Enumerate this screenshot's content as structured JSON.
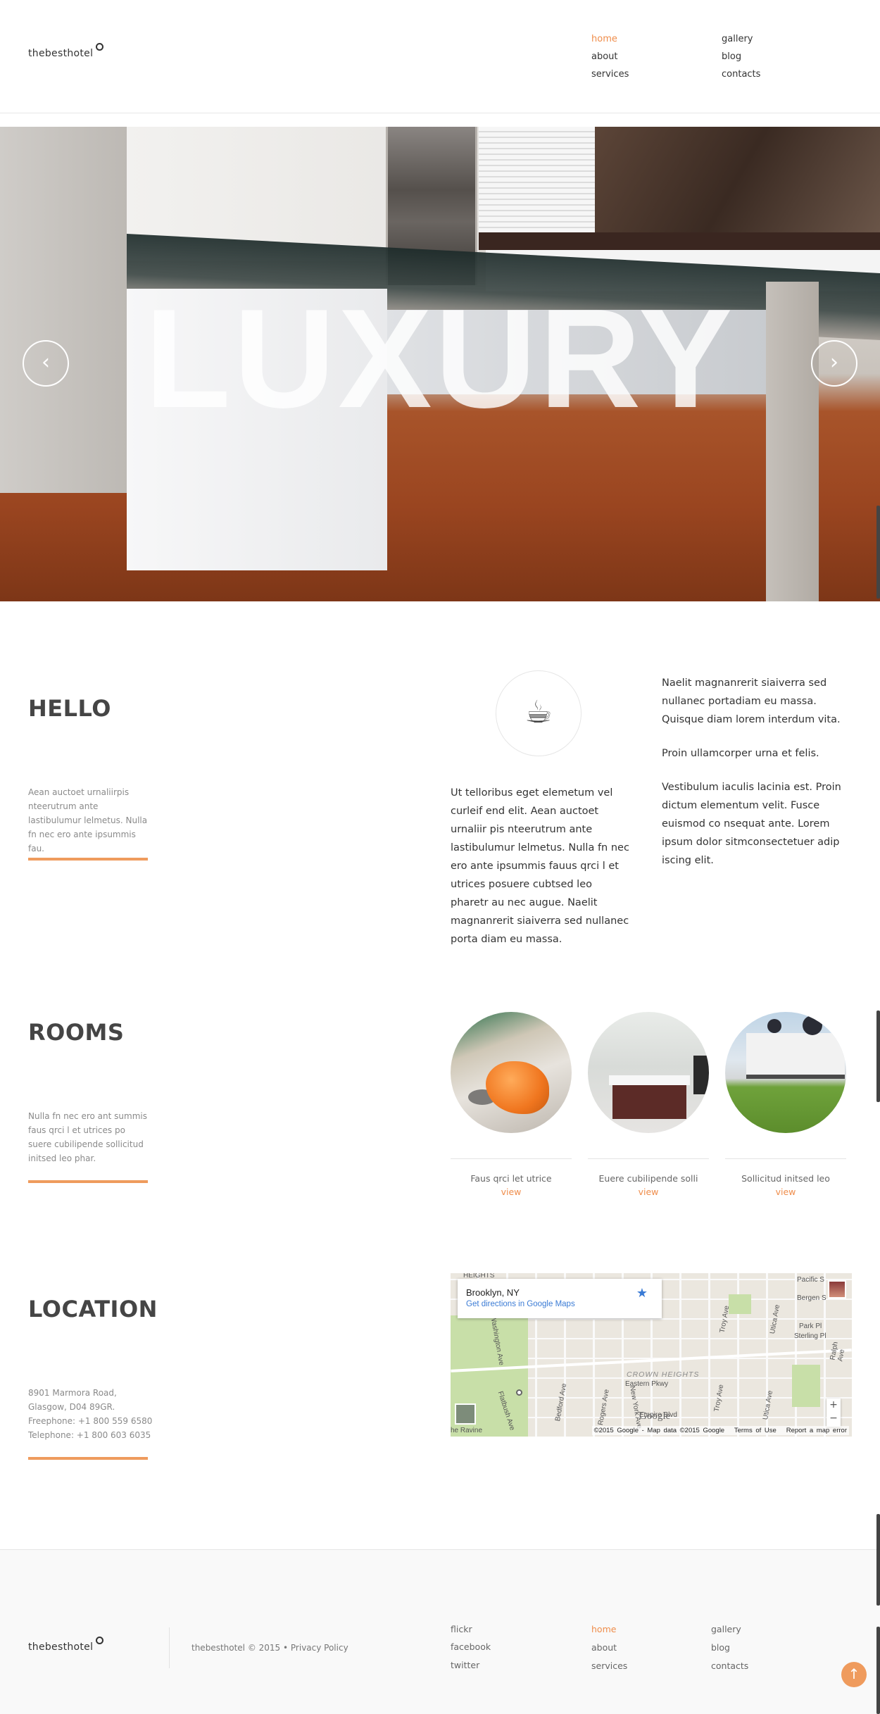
{
  "header": {
    "logo": "thebesthotel",
    "nav": [
      {
        "label": "home",
        "active": true
      },
      {
        "label": "about"
      },
      {
        "label": "services"
      },
      {
        "label": "gallery"
      },
      {
        "label": "blog"
      },
      {
        "label": "contacts"
      }
    ]
  },
  "hero": {
    "title": "LUXURY",
    "prev_icon": "chevron-left-icon",
    "next_icon": "chevron-right-icon"
  },
  "hello": {
    "title": "HELLO",
    "description": "Aean auctoet urnaliirpis nteerutrum ante lastibulumur lelmetus. Nulla fn nec ero ante ipsummis fau.",
    "icon": "coffee-cup-icon",
    "paragraph_main": "Ut telloribus eget elemetum vel curleif end elit. Aean auctoet urnaliir pis nteerutrum ante lastibulumur lelmetus. Nulla fn nec ero ante ipsummis fauus qrci l et utrices posuere cubtsed leo pharetr au nec augue. Naelit magnanrerit siaiverra sed nullanec porta diam eu massa.",
    "paragraph_1": "Naelit magnanrerit siaiverra sed nullanec portadiam eu massa. Quisque diam lorem interdum vita.",
    "paragraph_2": "Proin ullamcorper urna et felis.",
    "paragraph_3": "Vestibulum iaculis lacinia est. Proin dictum elementum velit. Fusce euismod co nsequat ante. Lorem ipsum dolor sitmconsectetuer adip iscing elit."
  },
  "rooms": {
    "title": "ROOMS",
    "description": "Nulla fn nec ero ant summis faus qrci l et utrices po suere cubilipende sollicitud initsed leo phar.",
    "items": [
      {
        "name": "Faus qrci let utrice",
        "link": "view"
      },
      {
        "name": "Euere cubilipende solli",
        "link": "view"
      },
      {
        "name": "Sollicitud initsed leo",
        "link": "view"
      }
    ]
  },
  "location": {
    "title": "LOCATION",
    "address_1": "8901 Marmora Road,",
    "address_2": "Glasgow, D04 89GR.",
    "freephone": "Freephone: +1 800 559 6580",
    "telephone": "Telephone: +1 800 603 6035",
    "map": {
      "place": "Brooklyn, NY",
      "directions": "Get directions in Google Maps",
      "district": "CROWN HEIGHTS",
      "heights": "HEIGHTS",
      "streets": {
        "eastern": "Eastern Pkwy",
        "empire": "Empire Blvd",
        "washington": "Washington Ave",
        "flatbush": "Flatbush Ave",
        "bedford": "Bedford Ave",
        "rogers": "Rogers Ave",
        "new_york": "New York Ave",
        "troy": "Troy Ave",
        "utica": "Utica Ave",
        "ralph": "Ralph Ave",
        "pacific": "Pacific S",
        "bergen": "Bergen S",
        "park_pl": "Park Pl",
        "sterling": "Sterling Pl",
        "ravine": "he Ravine"
      },
      "google_logo": "Google",
      "attribution": "©2015 Google - Map data ©2015 Google",
      "terms": "Terms of Use",
      "report": "Report a map error",
      "zoom_in": "+",
      "zoom_out": "−"
    }
  },
  "footer": {
    "logo": "thebesthotel",
    "copyright": "thebesthotel © 2015 • Privacy Policy",
    "social": [
      "flickr",
      "facebook",
      "twitter"
    ],
    "nav": [
      {
        "label": "home",
        "active": true
      },
      {
        "label": "about"
      },
      {
        "label": "services"
      },
      {
        "label": "gallery"
      },
      {
        "label": "blog"
      },
      {
        "label": "contacts"
      }
    ],
    "to_top_icon": "arrow-up-icon"
  },
  "colors": {
    "accent": "#ef8d4b",
    "rule": "#ef9b5d",
    "link_blue": "#3a7bd5"
  }
}
